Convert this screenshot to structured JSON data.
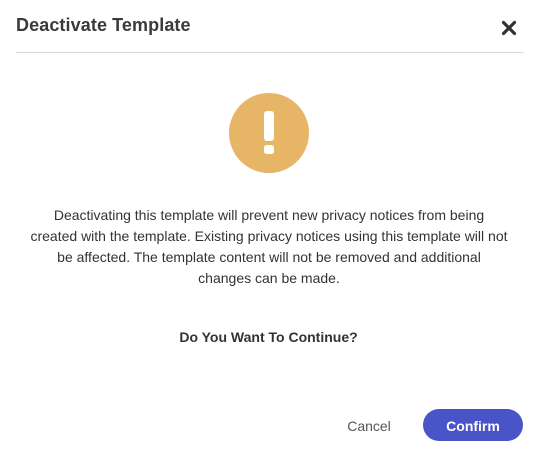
{
  "dialog": {
    "title": "Deactivate Template",
    "close_icon": "close-icon",
    "warning_icon": "exclamation-icon",
    "warning_color": "#e6b566",
    "message": "Deactivating this template will prevent new privacy notices from being created with the template. Existing privacy notices using this template will not be affected. The template content will not be removed and additional changes can be made.",
    "question": "Do You Want To Continue?",
    "cancel_label": "Cancel",
    "confirm_label": "Confirm",
    "confirm_color": "#4a54c9"
  }
}
